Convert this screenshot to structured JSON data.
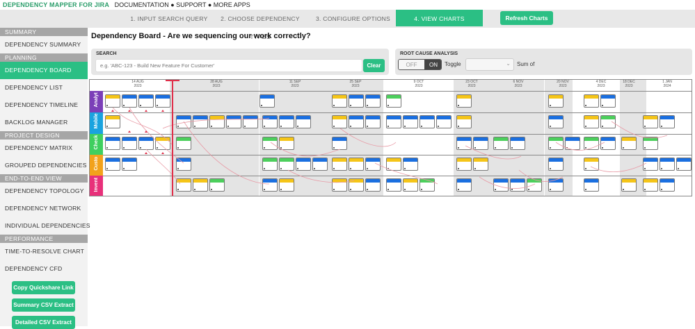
{
  "topbar": {
    "brand": "DEPENDENCY MAPPER FOR JIRA",
    "links": "DOCUMENTATION ● SUPPORT ● MORE APPS"
  },
  "steps": [
    {
      "label": "1. INPUT SEARCH QUERY",
      "active": false
    },
    {
      "label": "2. CHOOSE DEPENDENCY TYPES",
      "active": false
    },
    {
      "label": "3. CONFIGURE OPTIONS",
      "active": false
    },
    {
      "label": "4. VIEW CHARTS",
      "active": true
    }
  ],
  "refresh_label": "Refresh Charts",
  "sidebar": {
    "summary_head": "SUMMARY",
    "summary_items": [
      "DEPENDENCY SUMMARY"
    ],
    "planning_head": "PLANNING",
    "planning_items": [
      "DEPENDENCY BOARD",
      "DEPENDENCY LIST",
      "DEPENDENCY TIMELINE",
      "BACKLOG MANAGER"
    ],
    "design_head": "PROJECT DESIGN",
    "design_items": [
      "DEPENDENCY MATRIX",
      "GROUPED DEPENDENCIES"
    ],
    "e2e_head": "END-TO-END VIEW",
    "e2e_items": [
      "DEPENDENCY TOPOLOGY",
      "DEPENDENCY NETWORK",
      "INDIVIDUAL DEPENDENCIES"
    ],
    "perf_head": "PERFORMANCE",
    "perf_items": [
      "TIME-TO-RESOLVE CHART",
      "DEPENDENCY CFD"
    ],
    "buttons": [
      "Copy Quickshare Link",
      "Summary CSV Extract",
      "Detailed CSV Extract"
    ]
  },
  "page_title": "Dependency Board - Are we sequencing our work correctly?",
  "search": {
    "label": "SEARCH",
    "placeholder": "e.g. 'ABC-123 - Build New Feature For Customer'",
    "clear_label": "Clear"
  },
  "rca": {
    "label": "ROOT CAUSE ANALYSIS",
    "off": "OFF",
    "on": "ON",
    "toggle_label": "Toggle",
    "sum_label": "Sum of"
  },
  "board": {
    "dates": [
      {
        "day": "14 AUG",
        "year": "2023"
      },
      {
        "day": "28 AUG",
        "year": "2023"
      },
      {
        "day": "11 SEP",
        "year": "2023"
      },
      {
        "day": "25 SEP",
        "year": "2023"
      },
      {
        "day": "9 OCT",
        "year": "2023"
      },
      {
        "day": "23 OCT",
        "year": "2023"
      },
      {
        "day": "6 NOV",
        "year": "2023"
      },
      {
        "day": "20 NOV",
        "year": "2023"
      },
      {
        "day": "4 DEC",
        "year": "2023"
      },
      {
        "day": "18 DEC",
        "year": "2023"
      },
      {
        "day": "1 JAN",
        "year": "2024"
      }
    ],
    "lanes": [
      {
        "name": "Analyt",
        "color": "#7b3fb8"
      },
      {
        "name": "Mobile",
        "color": "#1aa3df"
      },
      {
        "name": "Check",
        "color": "#3fcf5f"
      },
      {
        "name": "Custo",
        "color": "#f2a21c"
      },
      {
        "name": "Invent",
        "color": "#e8307a"
      }
    ],
    "status_colors": {
      "todo": "#1a6fe0",
      "inprogress": "#f5c518",
      "done": "#4ccf5c"
    }
  }
}
